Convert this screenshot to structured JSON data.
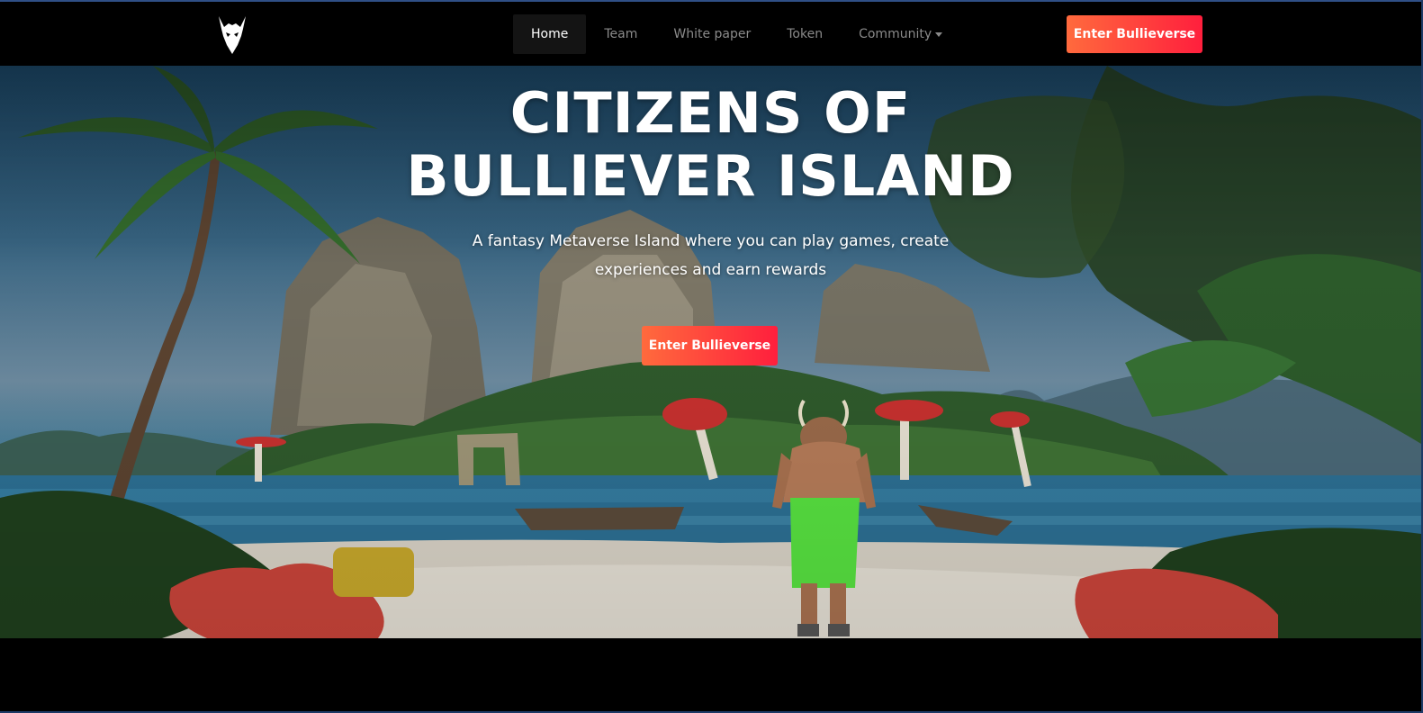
{
  "nav": {
    "logo_icon": "bull-head-logo-icon",
    "links": [
      {
        "label": "Home",
        "active": true
      },
      {
        "label": "Team",
        "active": false
      },
      {
        "label": "White paper",
        "active": false
      },
      {
        "label": "Token",
        "active": false
      },
      {
        "label": "Community",
        "active": false,
        "dropdown": true
      }
    ],
    "cta_label": "Enter Bullieverse"
  },
  "hero": {
    "title_line1": "CITIZENS OF",
    "title_line2": "BULLIEVER ISLAND",
    "subtitle_line1": "A fantasy Metaverse Island where you can play games, create",
    "subtitle_line2": "experiences and earn rewards",
    "cta_label": "Enter Bullieverse"
  },
  "colors": {
    "cta_gradient_start": "#ff6a3d",
    "cta_gradient_end": "#ff1f3d",
    "nav_bg": "#000000",
    "nav_active_bg": "#141414"
  }
}
